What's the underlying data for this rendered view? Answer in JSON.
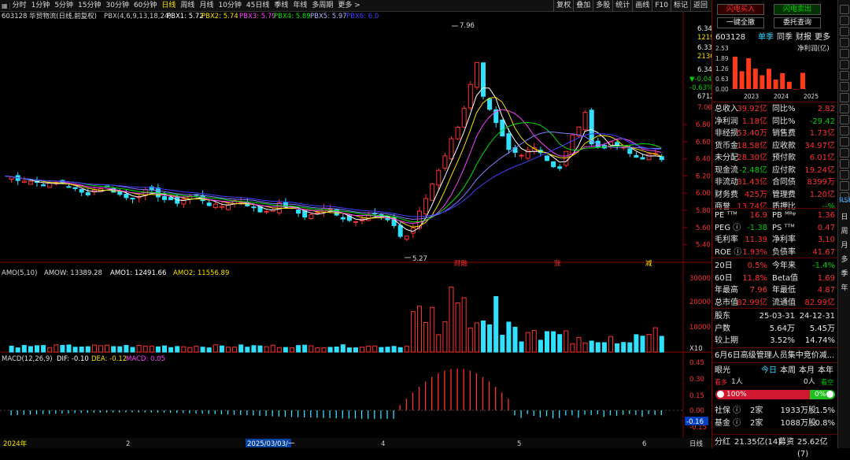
{
  "periods": [
    "分时",
    "1分钟",
    "5分钟",
    "15分钟",
    "30分钟",
    "60分钟",
    "日线",
    "周线",
    "月线",
    "10分钟",
    "45日线",
    "季线",
    "年线",
    "多周期",
    "更多 >"
  ],
  "active_period": "日线",
  "right_tools": [
    "复权",
    "叠加",
    "多股",
    "统计",
    "画线",
    "F10",
    "标记",
    "返回"
  ],
  "main_legend": {
    "code": "603128 华贸物流(日线,前复权)",
    "indicator": "PBX(4,6,9,13,18,24)",
    "pbx1": "PBX1: 5.72",
    "pbx2": "PBX2: 5.74",
    "pbx3": "PBX3: 5.79",
    "pbx4": "PBX4: 5.89",
    "pbx5": "PBX5: 5.97",
    "pbx6": "PBX6: 6.0"
  },
  "price_axis": [
    "6.80",
    "6.60",
    "6.40",
    "6.20",
    "6.00",
    "5.80",
    "5.60",
    "5.40"
  ],
  "price_side": {
    "p1": "6.34",
    "p2": "1219",
    "p3": "6.33",
    "p4": "2136",
    "p5": "6.34",
    "p6": "▼-0.04",
    "p7": "-0.63%",
    "p8": "6712",
    "p9": "7.00"
  },
  "high_label": "7.96",
  "low_label": "5.27",
  "markers": {
    "m1": "财融",
    "m2": "涨",
    "m3": "减"
  },
  "amo_legend": {
    "name": "AMO(5,10)",
    "amow": "AMOW: 13389.28",
    "amo1": "AMO1: 12491.66",
    "amo2": "AMO2: 11556.89"
  },
  "amo_axis": [
    "30000",
    "20000",
    "10000",
    "X10"
  ],
  "macd_legend": {
    "name": "MACD(12,26,9)",
    "dif": "DIF: -0.10",
    "dea": "DEA: -0.12",
    "macd": "MACD: 0.05"
  },
  "macd_axis": [
    "0.45",
    "0.30",
    "0.15",
    "0.00",
    "-0.15"
  ],
  "macd_current": "-0.16",
  "date_axis": {
    "d1": "2024年",
    "d2": "2",
    "d3": "2025/03/03/一",
    "d4": "4",
    "d5": "5",
    "d6": "6",
    "mode": "日线"
  },
  "rpanel": {
    "btn_buy": "闪电买入",
    "btn_sell": "闪电卖出",
    "btn_cancel": "一键全撤",
    "btn_query": "委托查询",
    "code": "603128",
    "tab1": "单季",
    "tab2": "同季",
    "tab3": "财报",
    "tab4": "更多",
    "net_profit_label": "净利润(亿)",
    "profit_axis": [
      "2.53",
      "1.89",
      "1.26",
      "0.63",
      "0.00"
    ],
    "profit_years": [
      "2023",
      "2024",
      "2025"
    ],
    "profit_values": [
      2.0,
      1.1,
      1.9,
      1.26,
      0.85,
      1.25,
      0.58,
      0.98,
      0.45,
      0.0,
      1.0
    ],
    "fin": [
      [
        "总收入",
        "39.92亿",
        "同比%",
        "2.82"
      ],
      [
        "净利润",
        "1.18亿",
        "同比%",
        "-29.42"
      ],
      [
        "非经损",
        "53.40万",
        "销售费",
        "1.73亿"
      ],
      [
        "货币金",
        "18.58亿",
        "应收款",
        "34.97亿"
      ],
      [
        "未分配",
        "28.30亿",
        "预付款",
        "6.01亿"
      ],
      [
        "现金流",
        "-2.48亿",
        "应付款",
        "19.24亿"
      ],
      [
        "非流动",
        "31.43亿",
        "合同债",
        "8399万"
      ],
      [
        "财务费",
        "425万",
        "管理费",
        "1.20亿"
      ],
      [
        "商誉",
        "13.74亿",
        "质押比",
        "--%"
      ]
    ],
    "val": [
      [
        "PE ᵀᵀᴹ",
        "16.9",
        "PB ᴹᴿᵠ",
        "1.36"
      ],
      [
        "PEG ⓘ",
        "-1.38",
        "PS ᵀᵀᴹ",
        "0.47"
      ],
      [
        "毛利率",
        "11.39",
        "净利率",
        "3.10"
      ],
      [
        "ROE ⓘ",
        "1.93%",
        "负债率",
        "41.67"
      ]
    ],
    "stats": [
      [
        "20日",
        "0.5%",
        "今年来",
        "-1.4%"
      ],
      [
        "60日",
        "11.8%",
        "Beta值",
        "1.69"
      ],
      [
        "年最高",
        "7.96",
        "年最低",
        "4.87"
      ],
      [
        "总市值",
        "82.99亿",
        "流通值",
        "82.99亿"
      ]
    ],
    "holders": [
      [
        "股东",
        "25-03-31",
        "24-12-31"
      ],
      [
        "户数",
        "5.64万",
        "5.45万"
      ],
      [
        "较上期",
        "3.52%",
        "14.74%"
      ]
    ],
    "news": "6月6日高级管理人员集中竞价减...",
    "yg_label": "眼光",
    "yg_tabs": [
      "今日",
      "本周",
      "本月",
      "本年"
    ],
    "bull": "看多",
    "bull_n": "1人",
    "bear_n": "0人",
    "bear": "看空",
    "bull_pct": "100%",
    "bear_pct": "0%",
    "inst": [
      [
        "社保 ⓘ",
        "2家",
        "1933万股",
        "1.5%"
      ],
      [
        "基金 ⓘ",
        "2家",
        "1088万股",
        "0.8%"
      ]
    ],
    "div_label": "分红",
    "div_val": "21.35亿(14)",
    "raise_label": "募资",
    "raise_val": "25.62亿(7)"
  },
  "sidebar_items": [
    "RSI",
    "日",
    "周",
    "月",
    "多",
    "季",
    "年"
  ],
  "colors": {
    "up": "#ff3030",
    "down": "#30e0ff",
    "pbx1": "#ffffff",
    "pbx2": "#f8e000",
    "pbx3": "#ff40ff",
    "pbx4": "#00e000",
    "pbx5": "#7f7fff",
    "pbx6": "#4040ff"
  },
  "chart_data": {
    "type": "candlestick",
    "indicator": "PBX(4,6,9,13,18,24)",
    "ylim": [
      5.27,
      7.96
    ],
    "annotations": {
      "high": 7.96,
      "low": 5.27
    },
    "amo_ylim": [
      0,
      33000
    ],
    "macd_ylim": [
      -0.2,
      0.5
    ]
  }
}
